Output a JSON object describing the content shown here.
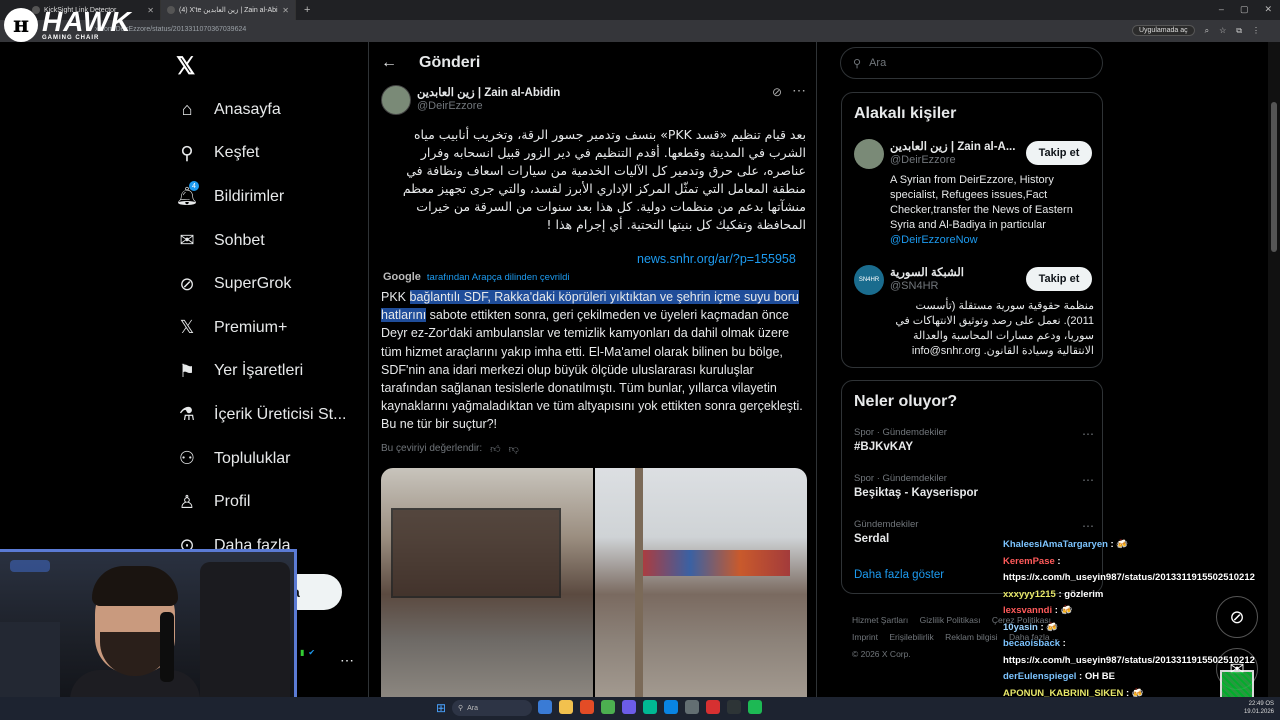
{
  "browser": {
    "tabs": [
      {
        "label": "KickSight Link Detector"
      },
      {
        "label": "(4) X'te زين العابدين | Zain al-Abi"
      }
    ],
    "url": "x.com/DeirEzzore/status/2013311070367039624",
    "app_chip": "Uygulamada aç",
    "win_controls": [
      "–",
      "▢",
      "✕"
    ]
  },
  "overlay": {
    "brand": "HAWK",
    "brand_sub": "GAMING CHAIR"
  },
  "nav": {
    "logo": "𝕏",
    "items": [
      {
        "label": "Anasayfa",
        "icon": "home-icon"
      },
      {
        "label": "Keşfet",
        "icon": "search-icon"
      },
      {
        "label": "Bildirimler",
        "icon": "bell-icon",
        "badge": "4"
      },
      {
        "label": "Sohbet",
        "icon": "mail-icon"
      },
      {
        "label": "SuperGrok",
        "icon": "grok-icon"
      },
      {
        "label": "Premium+",
        "icon": "x-icon"
      },
      {
        "label": "Yer İşaretleri",
        "icon": "bookmark-icon"
      },
      {
        "label": "İçerik Üreticisi St...",
        "icon": "creator-icon"
      },
      {
        "label": "Topluluklar",
        "icon": "communities-icon"
      },
      {
        "label": "Profil",
        "icon": "profile-icon"
      },
      {
        "label": "Daha fazla",
        "icon": "more-icon"
      }
    ],
    "post_label": "a"
  },
  "post": {
    "header_title": "Gönderi",
    "author": "زين العابدين | Zain al-Abidin",
    "handle": "@DeirEzzore",
    "arabic_text": "بعد قيام تنظيم «قسد PKK» بنسف وتدمير جسور الرقة، وتخريب أنابيب مياه الشرب في المدينة وقطعها. أقدم التنظيم في دير الزور قبيل انسحابه وفرار عناصره، على حرق وتدمير كل الآليات الخدمية من سيارات اسعاف ونظافة في منطقة المعامل التي تمثّل المركز الإداري الأبرز لقسد، والتي جرى تجهيز معظم منشآتها بدعم من منظمات دولية. كل هذا بعد سنوات من السرقة من خيرات المحافظة وتفكيك كل بنيتها التحتية. أي إجرام هذا !",
    "link": "news.snhr.org/ar/?p=155958",
    "translate_brand": "Google",
    "translate_note": "tarafından Arapça dilinden çevrildi",
    "tr_before": "PKK ",
    "tr_highlight": "bağlantılı SDF, Rakka'daki köprüleri yıktıktan ve şehrin içme suyu boru hatlarını",
    "tr_after": " sabote ettikten sonra, geri çekilmeden ve üyeleri kaçmadan önce Deyr ez-Zor'daki ambulanslar ve temizlik kamyonları da dahil olmak üzere tüm hizmet araçlarını yakıp imha etti. El-Ma'amel olarak bilinen bu bölge, SDF'nin ana idari merkezi olup büyük ölçüde uluslararası kuruluşlar tarafından sağlanan tesislerle donatılmıştı. Tüm bunlar, yıllarca vilayetin kaynaklarını yağmaladıktan ve tüm altyapısını yok ettikten sonra gerçekleşti. Bu ne tür bir suçtur?!",
    "rate_label": "Bu çeviriyi değerlendir:"
  },
  "right": {
    "search_placeholder": "Ara",
    "related_title": "Alakalı kişiler",
    "people": [
      {
        "name": "زين العابدين | Zain al-A...",
        "handle": "@DeirEzzore",
        "follow": "Takip et",
        "bio": "A Syrian from DeirEzzore, History specialist, Refugees issues,Fact Checker,transfer the News of Eastern Syria and Al-Badiya in particular",
        "bio_mention": "@DeirEzzoreNow"
      },
      {
        "name": "الشبكة السورية",
        "handle": "@SN4HR",
        "follow": "Takip et",
        "avatar_text": "SN4HR",
        "bio": "منظمة حقوقية سورية مستقلة (تأسست 2011). نعمل على رصد وتوثيق الانتهاكات في سوريا، ودعم مسارات المحاسبة والعدالة الانتقالية وسيادة القانون. info@snhr.org"
      }
    ],
    "trends_title": "Neler oluyor?",
    "trends": [
      {
        "meta": "Spor · Gündemdekiler",
        "name": "#BJKvKAY"
      },
      {
        "meta": "Spor · Gündemdekiler",
        "name": "Beşiktaş - Kayserispor"
      },
      {
        "meta": "Gündemdekiler",
        "name": "Serdal"
      }
    ],
    "show_more": "Daha fazla göster",
    "footer": [
      "Hizmet Şartları",
      "Gizlilik Politikası",
      "Çerez Politikası",
      "Imprint",
      "Erişilebilirlik",
      "Reklam bilgisi",
      "Daha fazla ...",
      "© 2026 X Corp."
    ]
  },
  "chat": [
    {
      "user": "KhaleesiAmaTargaryen",
      "msg": " : 🍻"
    },
    {
      "user": "KeremPase",
      "msg": " :"
    },
    {
      "user": "",
      "msg": "https://x.com/h_useyin987/status/2013311915502510212"
    },
    {
      "user": "xxxyyy1215",
      "msg": " : gözlerim"
    },
    {
      "user": "lexsvanndi",
      "msg": " : 🍻"
    },
    {
      "user": "10yasin",
      "msg": " : 🍻"
    },
    {
      "user": "becaoisback",
      "msg": " :"
    },
    {
      "user": "",
      "msg": "https://x.com/h_useyin987/status/2013311915502510212"
    },
    {
      "user": "derEulenspiegel",
      "msg": " : OH BE"
    },
    {
      "user": "APONUN_KABRINI_SIKEN",
      "msg": " : 🍻"
    }
  ],
  "taskbar": {
    "search": "Ara",
    "time": "22:49 OS",
    "date": "19.01.2026"
  }
}
